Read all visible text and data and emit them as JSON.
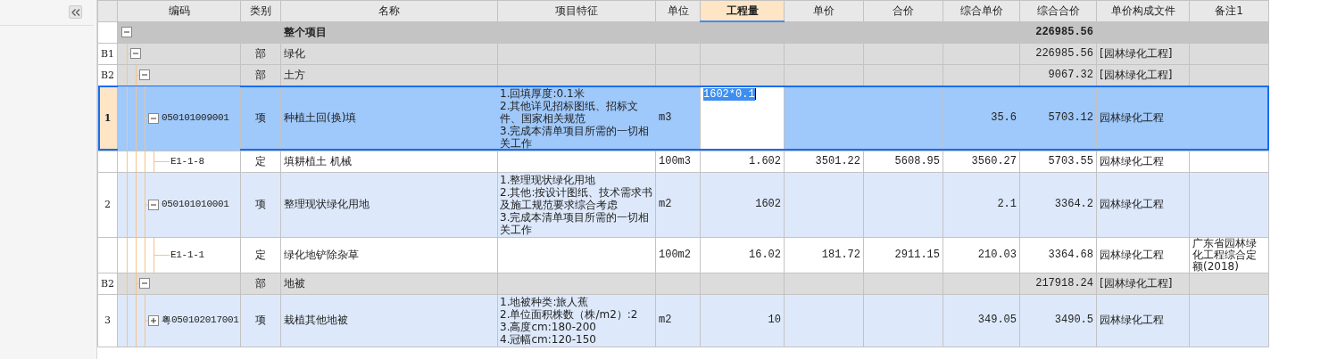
{
  "columns": [
    {
      "label": "编码",
      "selected": false
    },
    {
      "label": "类别",
      "selected": false
    },
    {
      "label": "名称",
      "selected": false
    },
    {
      "label": "项目特征",
      "selected": false
    },
    {
      "label": "单位",
      "selected": false
    },
    {
      "label": "工程量",
      "selected": true
    },
    {
      "label": "单价",
      "selected": false
    },
    {
      "label": "合价",
      "selected": false
    },
    {
      "label": "综合单价",
      "selected": false
    },
    {
      "label": "综合合价",
      "selected": false
    },
    {
      "label": "单价构成文件",
      "selected": false
    },
    {
      "label": "备注1",
      "selected": false
    }
  ],
  "rows": [
    {
      "kind": "project",
      "name": "整个项目",
      "comp_total": "226985.56",
      "expanded": true,
      "selected": false,
      "children": [
        {
          "kind": "section",
          "num": "B1",
          "type": "部",
          "name": "绿化",
          "comp_total": "226985.56",
          "price_file": "[园林绿化工程]",
          "expanded": true,
          "selected": false,
          "children": [
            {
              "kind": "section",
              "num": "B2",
              "type": "部",
              "name": "土方",
              "comp_total": "9067.32",
              "price_file": "[园林绿化工程]",
              "expanded": true,
              "selected": false,
              "children": [
                {
                  "kind": "item",
                  "num": "1",
                  "code": "050101009001",
                  "type": "项",
                  "name": "种植土回(换)填",
                  "features": "1.回填厚度:0.1米\n2.其他详见招标图纸、招标文件、国家相关规范\n3.完成本清单项目所需的一切相关工作",
                  "unit": "m3",
                  "quantity": "1602*0.1",
                  "editing": true,
                  "comp_unit_price": "35.6",
                  "comp_total": "5703.12",
                  "price_file": "园林绿化工程",
                  "expanded": true,
                  "selected": true,
                  "children": [
                    {
                      "kind": "quota",
                      "code": "E1-1-8",
                      "type": "定",
                      "name": "填耕植土 机械",
                      "unit": "100m3",
                      "quantity": "1.602",
                      "unit_price": "3501.22",
                      "total_price": "5608.95",
                      "comp_unit_price": "3560.27",
                      "comp_total": "5703.55",
                      "price_file": "园林绿化工程",
                      "selected": false
                    }
                  ]
                },
                {
                  "kind": "item",
                  "num": "2",
                  "code": "050101010001",
                  "type": "项",
                  "name": "整理现状绿化用地",
                  "features": "1.整理现状绿化用地\n2.其他:按设计图纸、技术需求书及施工规范要求综合考虑\n3.完成本清单项目所需的一切相关工作",
                  "unit": "m2",
                  "quantity": "1602",
                  "editing": false,
                  "comp_unit_price": "2.1",
                  "comp_total": "3364.2",
                  "price_file": "园林绿化工程",
                  "expanded": true,
                  "selected": false,
                  "children": [
                    {
                      "kind": "quota",
                      "code": "E1-1-1",
                      "type": "定",
                      "name": "绿化地铲除杂草",
                      "unit": "100m2",
                      "quantity": "16.02",
                      "unit_price": "181.72",
                      "total_price": "2911.15",
                      "comp_unit_price": "210.03",
                      "comp_total": "3364.68",
                      "price_file": "园林绿化工程",
                      "note1": "广东省园林绿化工程综合定额(2018)",
                      "selected": false
                    }
                  ]
                }
              ]
            },
            {
              "kind": "section",
              "num": "B2",
              "type": "部",
              "name": "地被",
              "comp_total": "217918.24",
              "price_file": "[园林绿化工程]",
              "expanded": true,
              "selected": false,
              "children": [
                {
                  "kind": "item",
                  "num": "3",
                  "prefix": "粤",
                  "code": "050102017001",
                  "type": "项",
                  "name": "栽植其他地被",
                  "features": "1.地被种类:旅人蕉\n2.单位面积株数（株/m2）:2\n3.高度cm:180-200\n4.冠幅cm:120-150",
                  "unit": "m2",
                  "quantity": "10",
                  "editing": false,
                  "comp_unit_price": "349.05",
                  "comp_total": "3490.5",
                  "price_file": "园林绿化工程",
                  "expanded": false,
                  "selected": false
                }
              ]
            }
          ]
        }
      ]
    }
  ]
}
